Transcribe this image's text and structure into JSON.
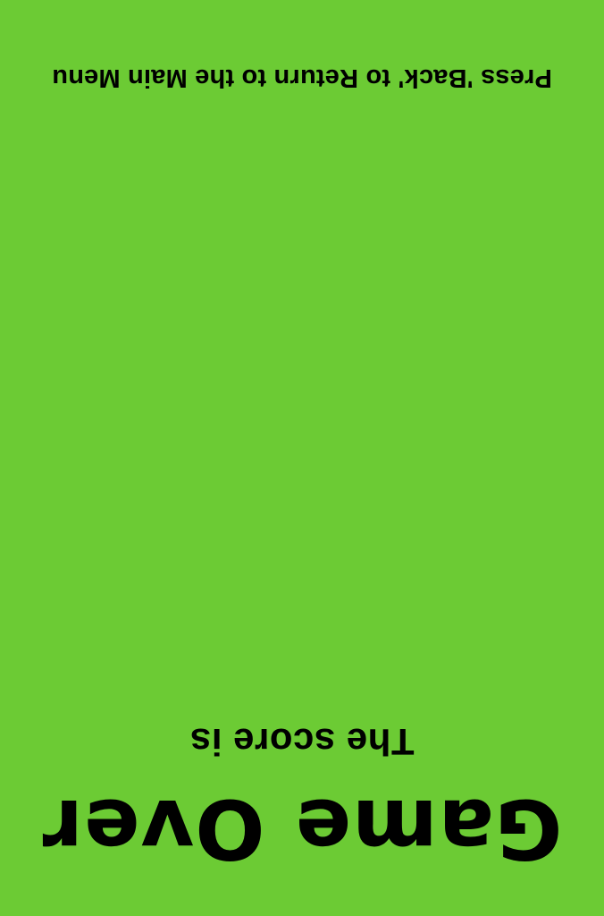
{
  "screen": {
    "background_color": "#6ccb34",
    "text_color": "#000000",
    "orientation": "rotated-180"
  },
  "title": "Game Over",
  "score_label": "The score is",
  "back_hint": "Press 'Back' to Return to the Main Menu"
}
